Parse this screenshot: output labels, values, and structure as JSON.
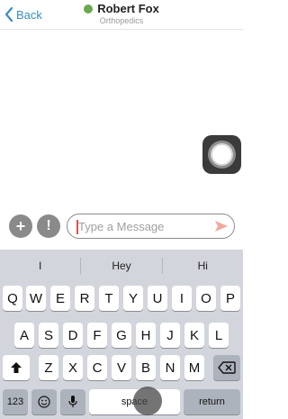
{
  "header": {
    "back_label": "Back",
    "contact_name": "Robert Fox",
    "specialty": "Orthopedics",
    "status_color": "#6aa84f",
    "accent_color": "#3a8ec2"
  },
  "composer": {
    "plus_label": "+",
    "alert_label": "!",
    "placeholder": "Type a Message",
    "value": "",
    "send_color": "#f1a9a0"
  },
  "keyboard": {
    "suggestions": [
      "I",
      "Hey",
      "Hi"
    ],
    "row1": [
      "Q",
      "W",
      "E",
      "R",
      "T",
      "Y",
      "U",
      "I",
      "O",
      "P"
    ],
    "row2": [
      "A",
      "S",
      "D",
      "F",
      "G",
      "H",
      "J",
      "K",
      "L"
    ],
    "row3": [
      "Z",
      "X",
      "C",
      "V",
      "B",
      "N",
      "M"
    ],
    "numbers_label": "123",
    "space_label": "space",
    "return_label": "return",
    "shift_icon": "shift-icon",
    "delete_icon": "delete-icon",
    "emoji_icon": "emoji-icon",
    "mic_icon": "microphone-icon"
  }
}
